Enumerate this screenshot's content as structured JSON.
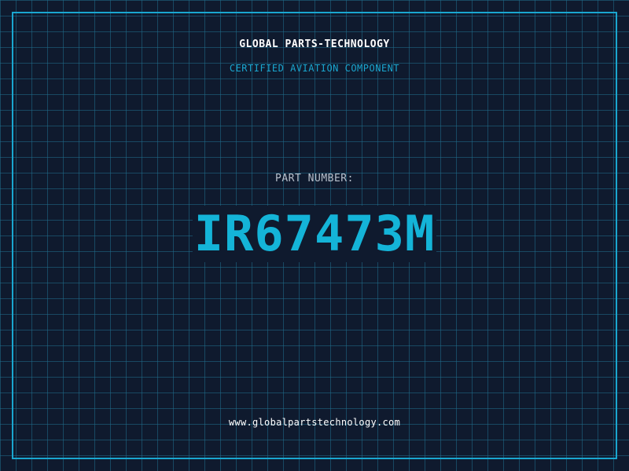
{
  "header": {
    "company_name": "GLOBAL PARTS-TECHNOLOGY",
    "tagline": "CERTIFIED AVIATION COMPONENT"
  },
  "part": {
    "label": "PART NUMBER:",
    "number": "IR67473M"
  },
  "footer": {
    "website": "www.globalpartstechnology.com"
  },
  "colors": {
    "background": "#0f1a2e",
    "grid": "#206e8c",
    "accent": "#1aa6cf",
    "part_number": "#14b4d8",
    "text_primary": "#ffffff",
    "text_muted": "#b8c0cc"
  }
}
